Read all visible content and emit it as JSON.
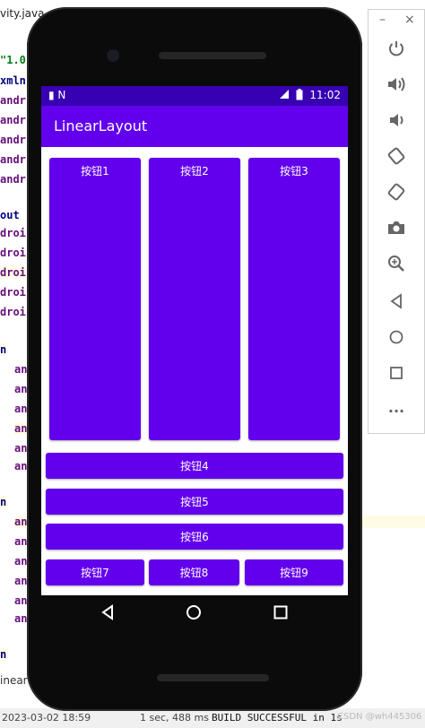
{
  "ide": {
    "tab_text": "vity.java",
    "code_lines": [
      "\"1.0",
      "xmln",
      "andr",
      "andr",
      "andr",
      "andr",
      "andr",
      "out",
      "droi",
      "droi",
      "droi",
      "droi",
      "droi",
      "n",
      "an",
      "an",
      "an",
      "an",
      "an",
      "an",
      "n",
      "an",
      "an",
      "an",
      "an",
      "an",
      "an",
      "n"
    ],
    "bottom_tab": "inearLa",
    "status": {
      "timestamp": "2023-03-02 18:59",
      "duration": "1 sec, 488 ms",
      "build": "BUILD SUCCESSFUL in 1s",
      "watermark": "CSDN @wh445306"
    }
  },
  "emulator_toolbar": {
    "minimize": "–",
    "close": "×",
    "buttons": [
      "power-icon",
      "volume-up-icon",
      "volume-down-icon",
      "rotate-left-icon",
      "rotate-right-icon",
      "camera-icon",
      "zoom-icon",
      "back-icon",
      "home-icon",
      "overview-icon",
      "more-icon"
    ],
    "more_label": "···"
  },
  "status_bar": {
    "time": "11:02",
    "left_icons": "▮ N"
  },
  "app_bar": {
    "title": "LinearLayout"
  },
  "buttons": {
    "b1": "按钮1",
    "b2": "按钮2",
    "b3": "按钮3",
    "b4": "按钮4",
    "b5": "按钮5",
    "b6": "按钮6",
    "b7": "按钮7",
    "b8": "按钮8",
    "b9": "按钮9"
  },
  "colors": {
    "primary": "#6200ee",
    "primary_dark": "#3700b3"
  }
}
